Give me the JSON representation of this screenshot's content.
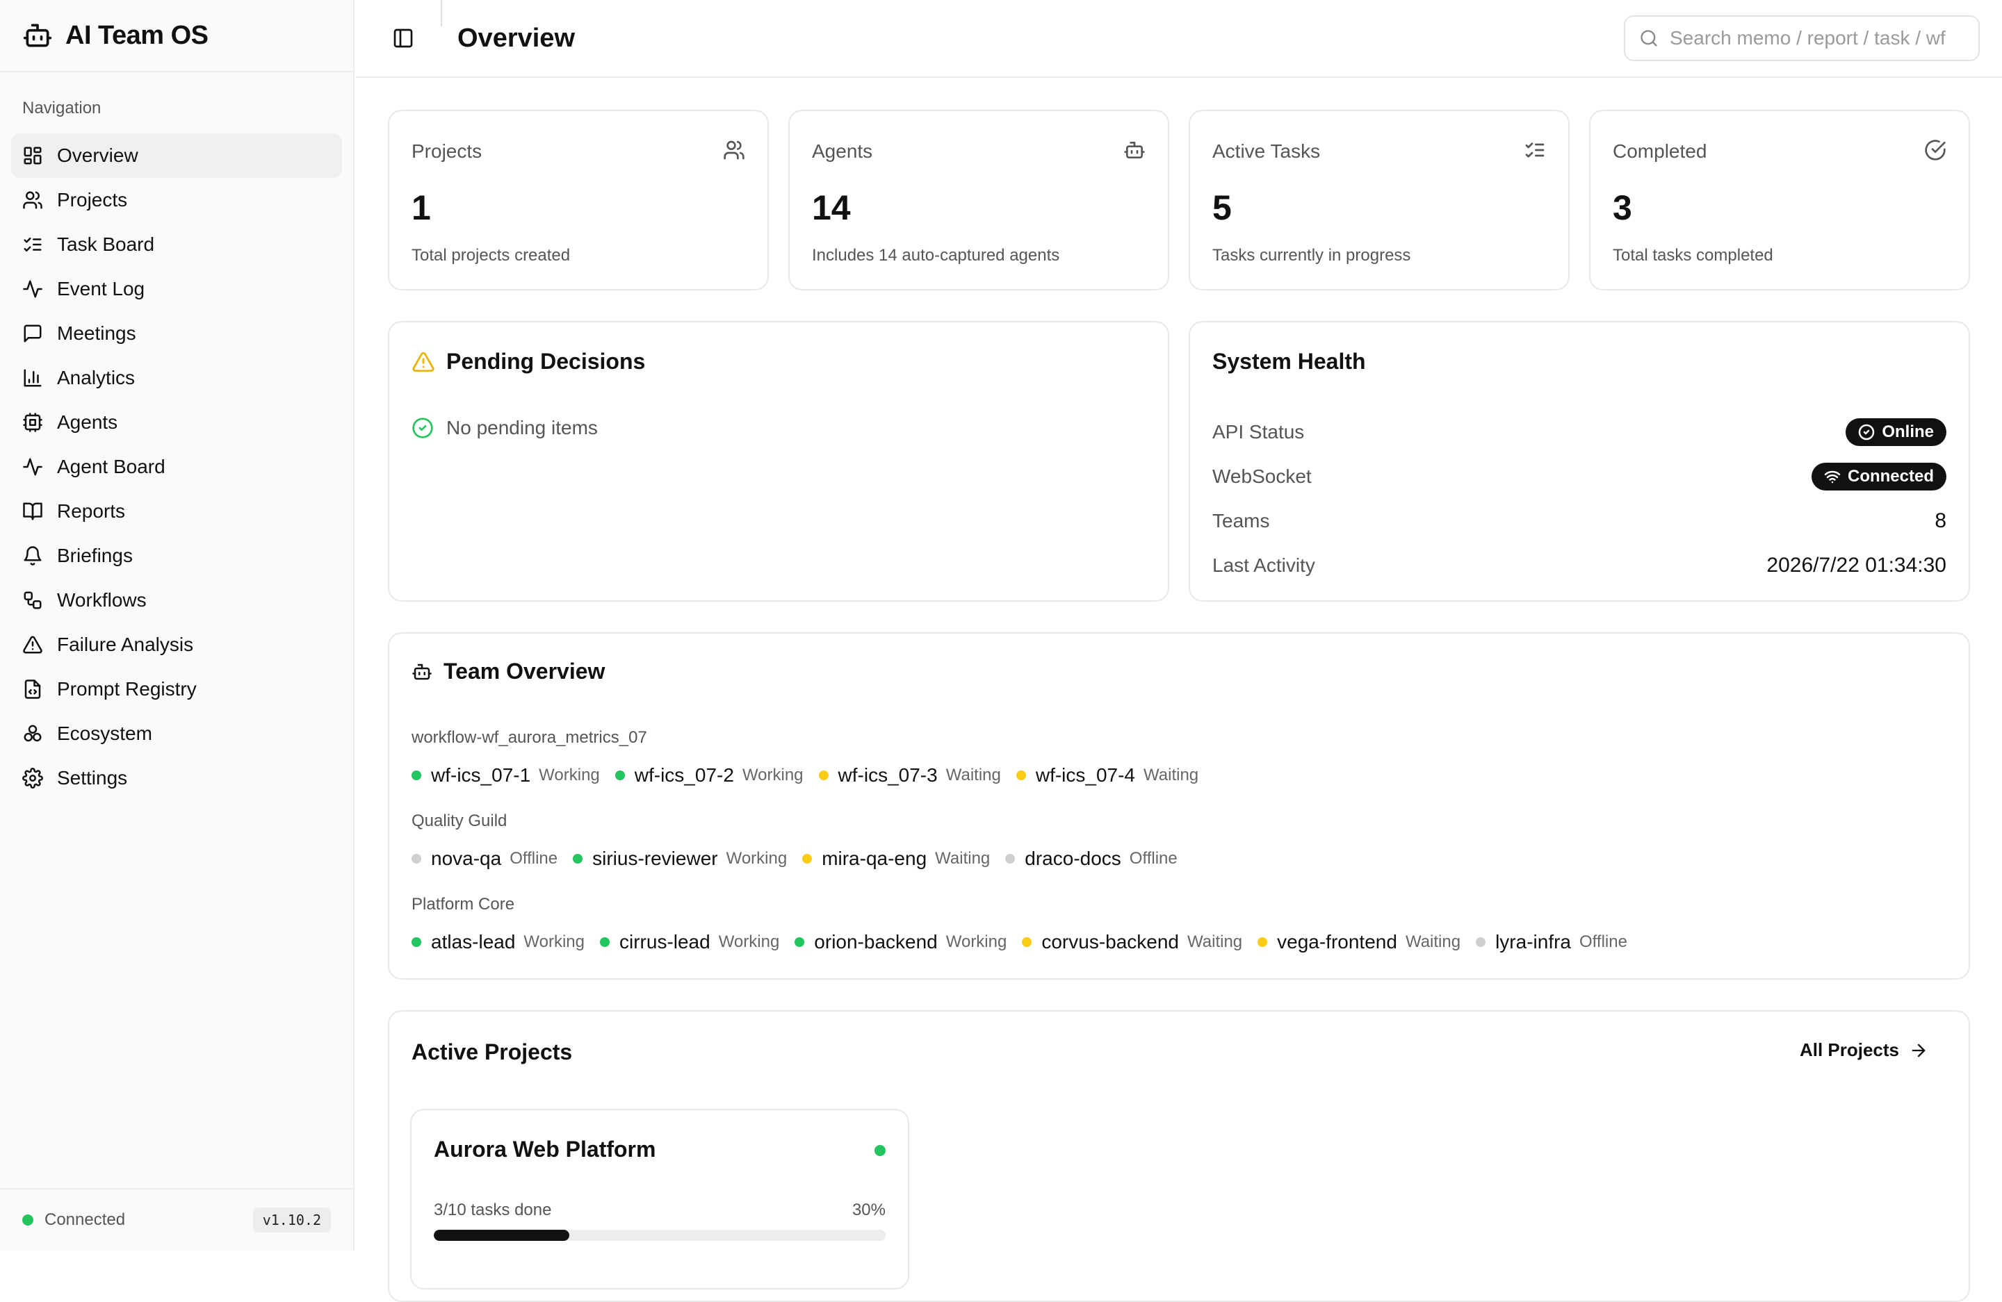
{
  "app": {
    "title": "AI Team OS",
    "version": "v1.10.2",
    "connection_status": "Connected"
  },
  "sidebar": {
    "heading": "Navigation",
    "items": [
      {
        "label": "Overview",
        "icon": "grid-icon",
        "active": true
      },
      {
        "label": "Projects",
        "icon": "users-icon"
      },
      {
        "label": "Task Board",
        "icon": "list-checks-icon"
      },
      {
        "label": "Event Log",
        "icon": "activity-icon"
      },
      {
        "label": "Meetings",
        "icon": "message-square-icon"
      },
      {
        "label": "Analytics",
        "icon": "bar-chart-icon"
      },
      {
        "label": "Agents",
        "icon": "cpu-icon"
      },
      {
        "label": "Agent Board",
        "icon": "activity-icon"
      },
      {
        "label": "Reports",
        "icon": "book-icon"
      },
      {
        "label": "Briefings",
        "icon": "bell-icon"
      },
      {
        "label": "Workflows",
        "icon": "workflow-icon"
      },
      {
        "label": "Failure Analysis",
        "icon": "alert-triangle-icon"
      },
      {
        "label": "Prompt Registry",
        "icon": "file-code-icon"
      },
      {
        "label": "Ecosystem",
        "icon": "boxes-icon"
      },
      {
        "label": "Settings",
        "icon": "gear-icon"
      }
    ]
  },
  "header": {
    "title": "Overview",
    "search_placeholder": "Search memo / report / task / wf"
  },
  "stats": [
    {
      "label": "Projects",
      "value": "1",
      "desc": "Total projects created",
      "icon": "users-icon"
    },
    {
      "label": "Agents",
      "value": "14",
      "desc": "Includes 14 auto-captured agents",
      "icon": "bot-icon"
    },
    {
      "label": "Active Tasks",
      "value": "5",
      "desc": "Tasks currently in progress",
      "icon": "list-checks-icon"
    },
    {
      "label": "Completed",
      "value": "3",
      "desc": "Total tasks completed",
      "icon": "check-circle-icon"
    }
  ],
  "pending": {
    "title": "Pending Decisions",
    "empty_text": "No pending items"
  },
  "health": {
    "title": "System Health",
    "api_label": "API Status",
    "api_value": "Online",
    "ws_label": "WebSocket",
    "ws_value": "Connected",
    "teams_label": "Teams",
    "teams_value": "8",
    "activity_label": "Last Activity",
    "activity_value": "2026/7/22 01:34:30"
  },
  "team_overview": {
    "title": "Team Overview",
    "groups": [
      {
        "name": "workflow-wf_aurora_metrics_07",
        "agents": [
          {
            "name": "wf-ics_07-1",
            "status": "Working"
          },
          {
            "name": "wf-ics_07-2",
            "status": "Working"
          },
          {
            "name": "wf-ics_07-3",
            "status": "Waiting"
          },
          {
            "name": "wf-ics_07-4",
            "status": "Waiting"
          }
        ]
      },
      {
        "name": "Quality Guild",
        "agents": [
          {
            "name": "nova-qa",
            "status": "Offline"
          },
          {
            "name": "sirius-reviewer",
            "status": "Working"
          },
          {
            "name": "mira-qa-eng",
            "status": "Waiting"
          },
          {
            "name": "draco-docs",
            "status": "Offline"
          }
        ]
      },
      {
        "name": "Platform Core",
        "agents": [
          {
            "name": "atlas-lead",
            "status": "Working"
          },
          {
            "name": "cirrus-lead",
            "status": "Working"
          },
          {
            "name": "orion-backend",
            "status": "Working"
          },
          {
            "name": "corvus-backend",
            "status": "Waiting"
          },
          {
            "name": "vega-frontend",
            "status": "Waiting"
          },
          {
            "name": "lyra-infra",
            "status": "Offline"
          }
        ]
      }
    ]
  },
  "status_colors": {
    "Working": "#22c55e",
    "Waiting": "#facc15",
    "Offline": "#cfcfcf"
  },
  "active_projects": {
    "title": "Active Projects",
    "all_link": "All Projects",
    "projects": [
      {
        "name": "Aurora Web Platform",
        "progress_text": "3/10 tasks done",
        "percent_label": "30%",
        "progress": 0.3
      }
    ]
  }
}
